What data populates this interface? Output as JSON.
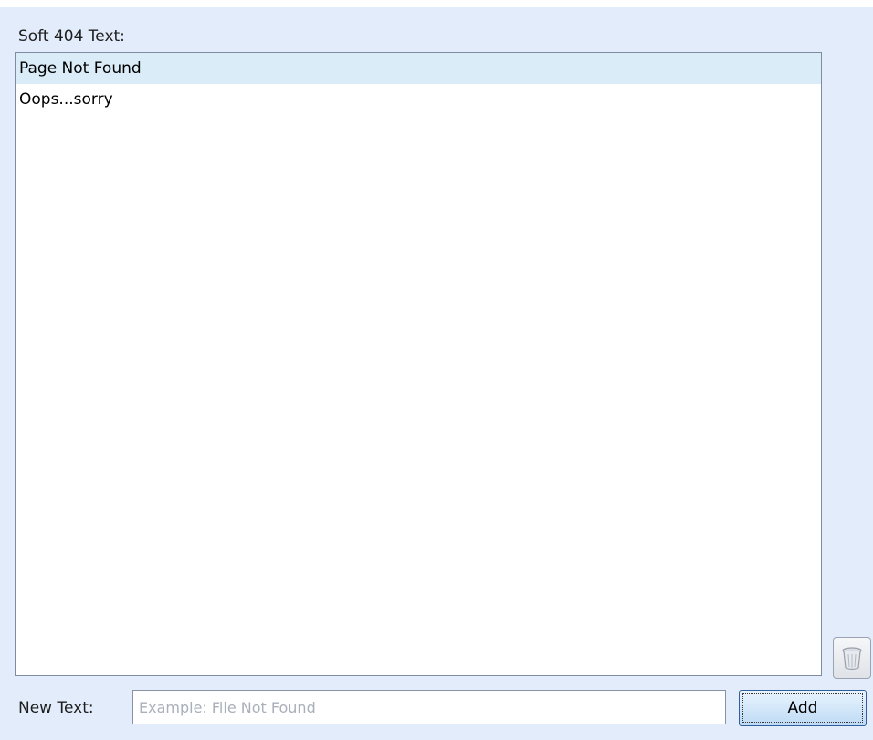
{
  "soft404": {
    "section_label": "Soft 404 Text:",
    "items": [
      {
        "text": "Page Not Found",
        "selected": true
      },
      {
        "text": "Oops...sorry",
        "selected": false
      }
    ]
  },
  "new_text": {
    "label": "New Text:",
    "value": "",
    "placeholder": "Example: File Not Found"
  },
  "buttons": {
    "add_label": "Add",
    "delete_icon": "trash-can-icon"
  },
  "colors": {
    "panel_background": "#e3ecfb",
    "selected_row": "#daecf7",
    "default_button_border": "#2f5f9e"
  }
}
